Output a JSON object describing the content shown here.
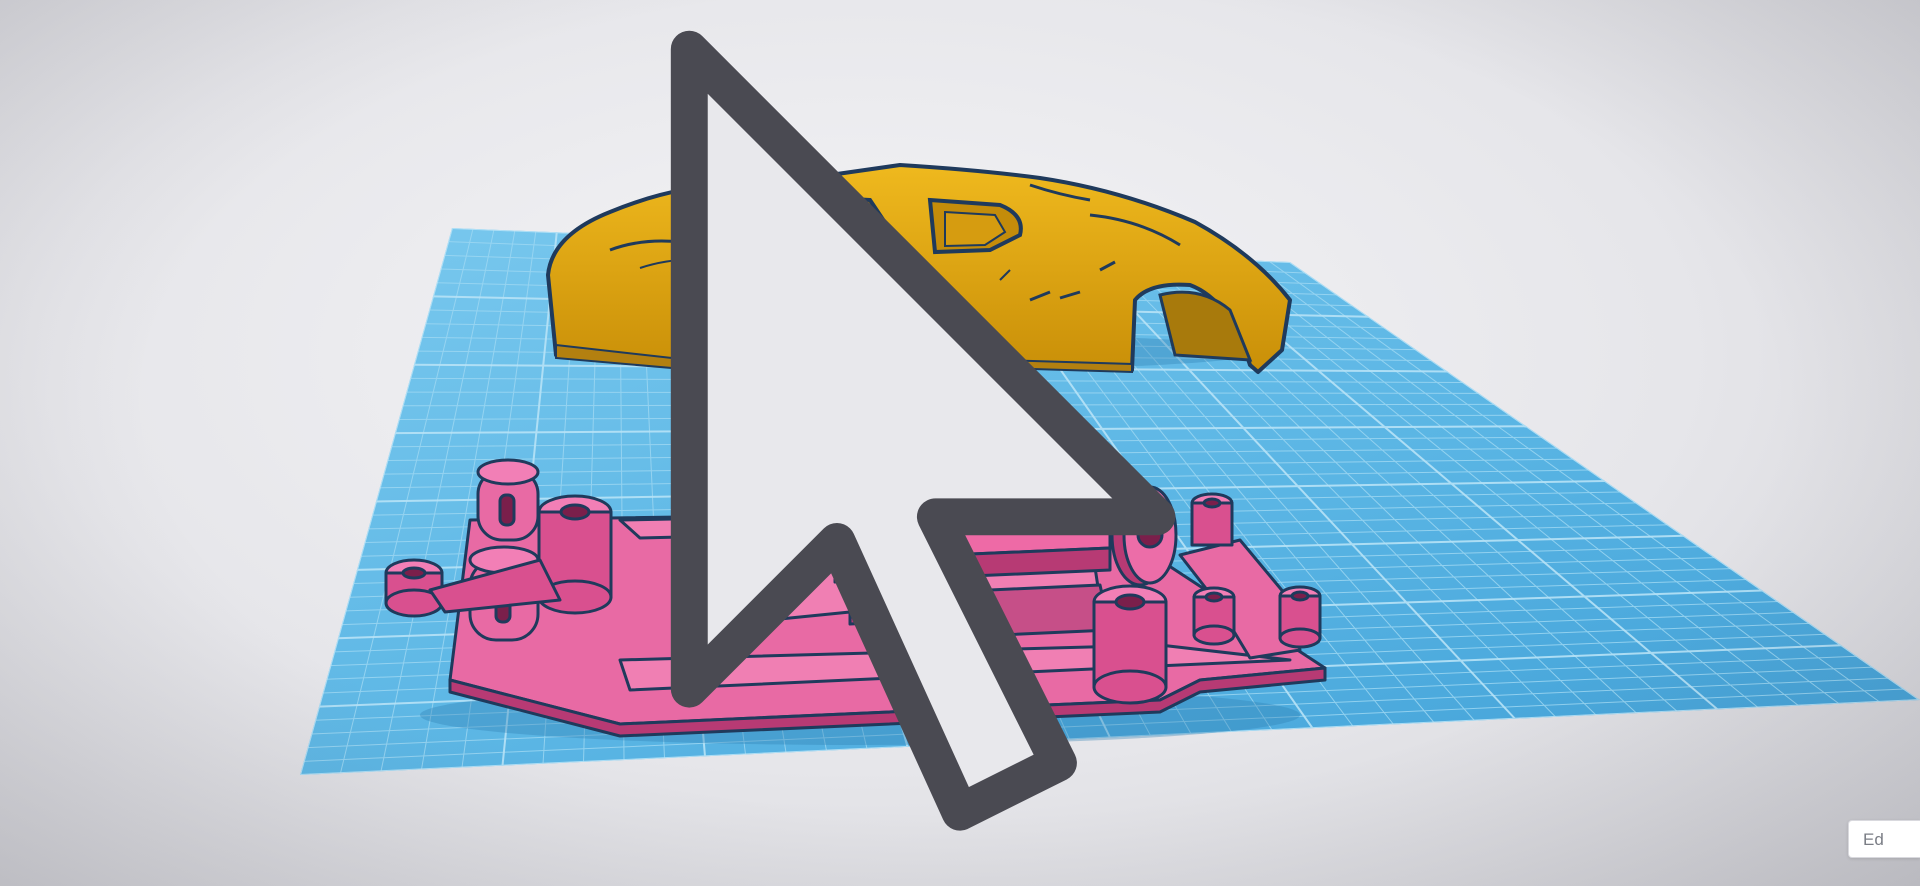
{
  "viewport": {
    "name": "3d-design-workplane",
    "colors": {
      "workplane": "#5fb8e6",
      "grid_line": "#8fd0ef",
      "body_shell": "#e2a815",
      "chassis": "#e0579a",
      "outline": "#1f3a5c"
    }
  },
  "objects": [
    {
      "name": "car-body-shell",
      "color": "#e2a815"
    },
    {
      "name": "slot-car-chassis",
      "color": "#e0579a"
    }
  ],
  "edit_button": {
    "label": "Ed",
    "icon": "edit-grid-icon"
  },
  "cursor": {
    "icon": "mouse-pointer-icon"
  }
}
